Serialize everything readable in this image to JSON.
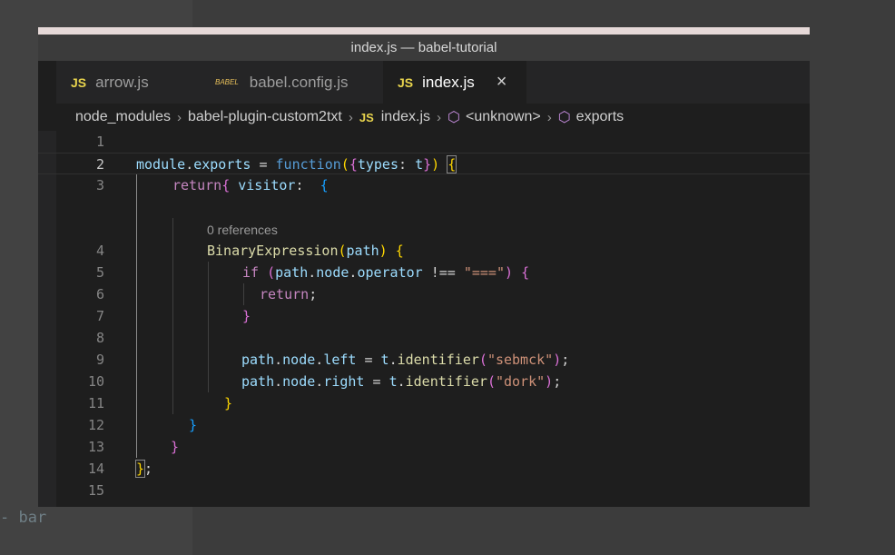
{
  "window": {
    "title": "index.js — babel-tutorial"
  },
  "tabs": [
    {
      "label": "arrow.js",
      "icon": "js-file-icon",
      "active": false
    },
    {
      "label": "babel.config.js",
      "icon": "babel-file-icon",
      "active": false
    },
    {
      "label": "index.js",
      "icon": "js-file-icon",
      "active": true
    }
  ],
  "breadcrumb": {
    "items": [
      "node_modules",
      "babel-plugin-custom2txt",
      "index.js",
      "<unknown>",
      "exports"
    ]
  },
  "editor": {
    "codelens": "0 references",
    "current_line": 2,
    "lines": [
      {
        "n": "1"
      },
      {
        "n": "2"
      },
      {
        "n": "3"
      },
      {
        "n": "4"
      },
      {
        "n": "5"
      },
      {
        "n": "6"
      },
      {
        "n": "7"
      },
      {
        "n": "8"
      },
      {
        "n": "9"
      },
      {
        "n": "10"
      },
      {
        "n": "11"
      },
      {
        "n": "12"
      },
      {
        "n": "13"
      },
      {
        "n": "14"
      },
      {
        "n": "15"
      }
    ],
    "tokens": {
      "l2": [
        "module",
        ".",
        "exports",
        " = ",
        "function",
        "(",
        "{",
        "types",
        ": ",
        "t",
        "}",
        ")",
        " ",
        "{"
      ],
      "l3": [
        "return",
        "{",
        " visitor",
        ":",
        "  ",
        "{"
      ],
      "l4": [
        "BinaryExpression",
        "(",
        "path",
        ")",
        " ",
        "{"
      ],
      "l5": [
        "if",
        " ",
        "(",
        "path",
        ".",
        "node",
        ".",
        "operator",
        " !== ",
        "\"===\"",
        ")",
        " ",
        "{"
      ],
      "l6": [
        "return",
        ";"
      ],
      "l7": [
        "}"
      ],
      "l9": [
        "path",
        ".",
        "node",
        ".",
        "left",
        " = ",
        "t",
        ".",
        "identifier",
        "(",
        "\"sebmck\"",
        ")",
        ";"
      ],
      "l10": [
        "path",
        ".",
        "node",
        ".",
        "right",
        " = ",
        "t",
        ".",
        "identifier",
        "(",
        "\"dork\"",
        ")",
        ";"
      ],
      "l11": [
        "}"
      ],
      "l12": [
        "}"
      ],
      "l13": [
        "}"
      ],
      "l14": [
        "}",
        ";"
      ]
    }
  },
  "background": {
    "fragment": "bar"
  },
  "colors": {
    "keyword": "#c586c0",
    "function_kw": "#569cd6",
    "variable": "#9cdcfe",
    "function_call": "#dcdcaa",
    "string": "#ce9178",
    "bracket_level1": "#ffd700",
    "bracket_level2": "#da70d6",
    "bracket_level3": "#179fff"
  }
}
